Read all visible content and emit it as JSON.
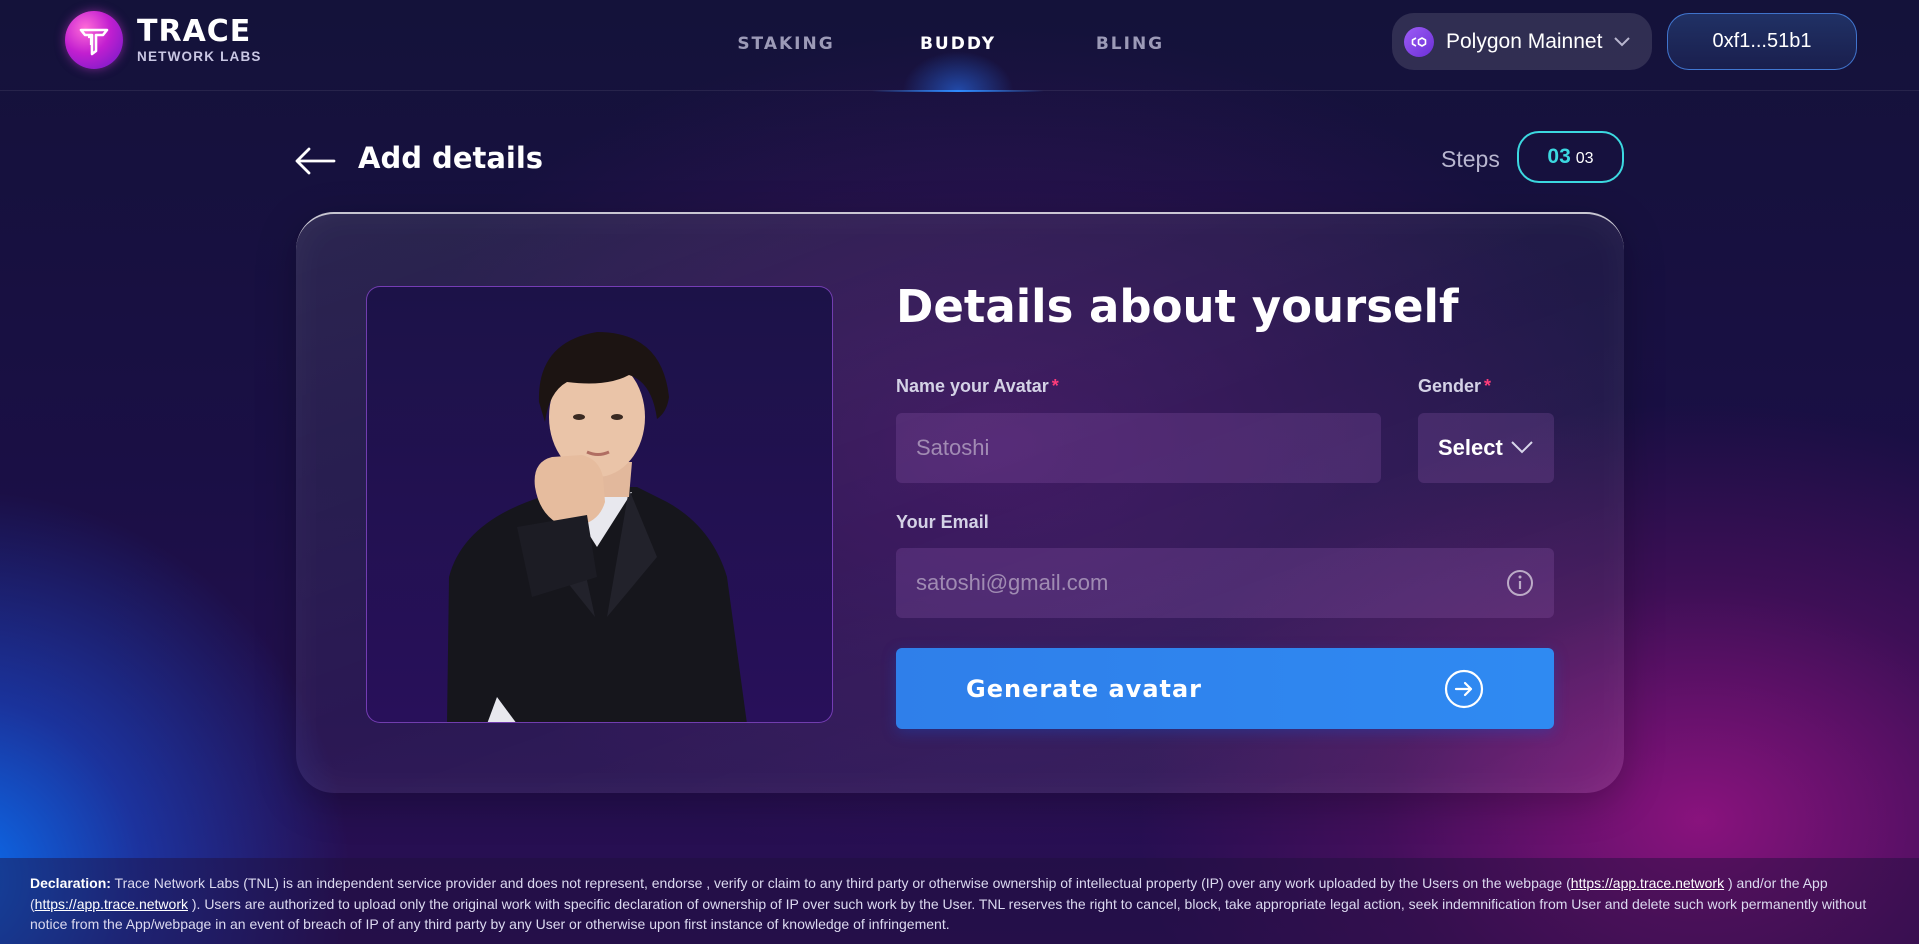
{
  "brand": {
    "title": "TRACE",
    "subtitle": "NETWORK LABS"
  },
  "nav": {
    "items": [
      {
        "label": "STAKING",
        "active": false
      },
      {
        "label": "BUDDY",
        "active": true
      },
      {
        "label": "BLING",
        "active": false
      }
    ]
  },
  "network": {
    "label": "Polygon Mainnet",
    "icon": "polygon-icon"
  },
  "wallet": {
    "address": "0xf1...51b1"
  },
  "header": {
    "title": "Add details",
    "steps_label": "Steps",
    "step_current": "03",
    "step_total": "03"
  },
  "form": {
    "title": "Details about yourself",
    "name_label": "Name your Avatar",
    "name_placeholder": "Satoshi",
    "gender_label": "Gender",
    "gender_value": "Select",
    "email_label": "Your Email",
    "email_placeholder": "satoshi@gmail.com",
    "required_marker": "*",
    "submit_label": "Generate avatar"
  },
  "footer": {
    "lead": "Declaration:",
    "text1": " Trace Network Labs (TNL) is an independent service provider and does not represent, endorse , verify or claim to any third party or otherwise ownership of intellectual property (IP) over any work uploaded by the Users on the webpage (",
    "link1": "https://app.trace.network",
    "text2": " ) and/or the App (",
    "link2": "https://app.trace.network",
    "text3": " ). Users are authorized to upload only the original work with specific declaration of ownership of IP over such work by the User. TNL reserves the right to cancel, block, take appropriate legal action, seek indemnification from User and delete such work permanently without notice from the App/webpage in an event of breach of IP of any third party by any User or otherwise upon first instance of knowledge of infringement."
  },
  "colors": {
    "accent_cyan": "#3cd8e0",
    "button_blue": "#2f8af2",
    "required_red": "#ff3c7a"
  }
}
